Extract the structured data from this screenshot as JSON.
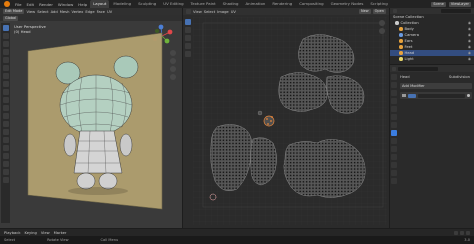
{
  "workspace_tabs": {
    "menus": [
      "File",
      "Edit",
      "Render",
      "Window",
      "Help"
    ],
    "tabs": [
      "Layout",
      "Modeling",
      "Sculpting",
      "UV Editing",
      "Texture Paint",
      "Shading",
      "Animation",
      "Rendering",
      "Compositing",
      "Geometry Nodes",
      "Scripting"
    ],
    "active": "Layout",
    "scene": "Scene",
    "view_layer": "ViewLayer"
  },
  "viewport": {
    "mode": "Edit Mode",
    "menus": [
      "View",
      "Select",
      "Add",
      "Mesh",
      "Vertex",
      "Edge",
      "Face",
      "UV"
    ],
    "transform": "Global",
    "overlay_text": "User Perspective",
    "overlay_sub": "(0) Head",
    "gizmo": {
      "x": "X",
      "y": "Y",
      "z": "Z"
    }
  },
  "uv_editor": {
    "menus": [
      "View",
      "Select",
      "Image",
      "UV"
    ],
    "image_name": "New",
    "open_label": "Open"
  },
  "outliner": {
    "title": "Scene Collection",
    "items": [
      {
        "label": "Collection",
        "color": "#cccccc",
        "selected": false
      },
      {
        "label": "Body",
        "color": "#e8a33d",
        "selected": false
      },
      {
        "label": "Camera",
        "color": "#6a9ae0",
        "selected": false
      },
      {
        "label": "Ears",
        "color": "#e8a33d",
        "selected": false
      },
      {
        "label": "Feet",
        "color": "#e8a33d",
        "selected": false
      },
      {
        "label": "Head",
        "color": "#e8a33d",
        "selected": true
      },
      {
        "label": "Light",
        "color": "#e8d76a",
        "selected": false
      }
    ]
  },
  "properties": {
    "object": "Head",
    "modifier_name": "Subdivision",
    "add_modifier": "Add Modifier"
  },
  "timeline": {
    "items": [
      "Playback",
      "Keying",
      "View",
      "Marker"
    ]
  },
  "statusbar": {
    "items": [
      "Select",
      "Rotate View",
      "Call Menu"
    ],
    "version": "3.0"
  }
}
